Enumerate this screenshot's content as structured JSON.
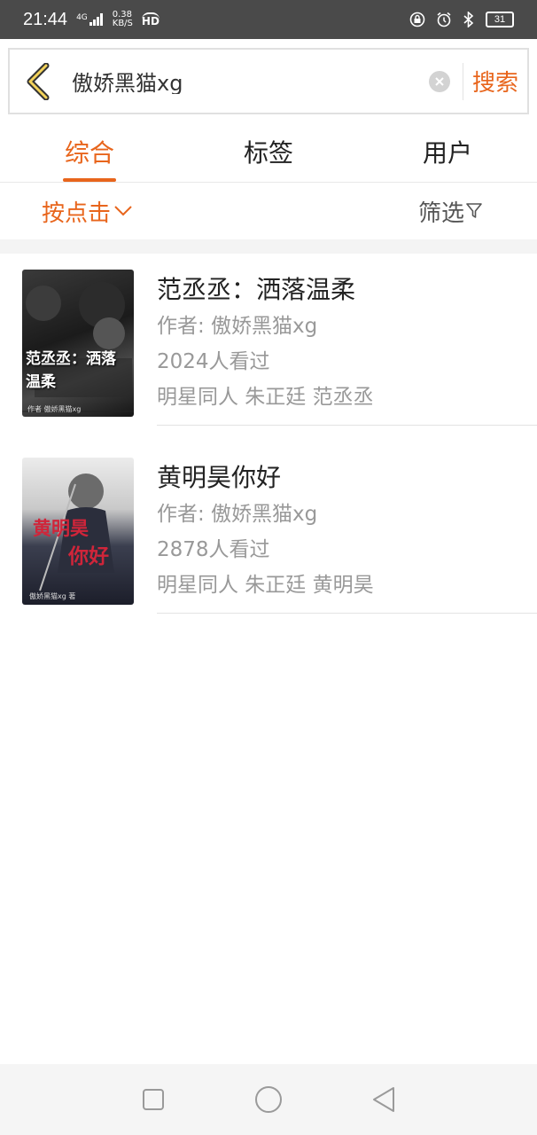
{
  "status_bar": {
    "time": "21:44",
    "network": "4G",
    "speed_value": "0.38",
    "speed_unit": "KB/S",
    "hd": "HD",
    "battery": "31"
  },
  "search": {
    "query": "傲娇黑猫xg",
    "button_label": "搜索"
  },
  "tabs": [
    {
      "label": "综合",
      "active": true
    },
    {
      "label": "标签",
      "active": false
    },
    {
      "label": "用户",
      "active": false
    }
  ],
  "filter_bar": {
    "sort_label": "按点击",
    "filter_label": "筛选"
  },
  "results": [
    {
      "title": "范丞丞：洒落温柔",
      "author": "作者: 傲娇黑猫xg",
      "views": "2024人看过",
      "tags": "明星同人 朱正廷 范丞丞",
      "cover_text": "范丞丞：洒落温柔",
      "cover_credit": "作者 傲娇黑猫xg"
    },
    {
      "title": "黄明昊你好",
      "author": "作者: 傲娇黑猫xg",
      "views": "2878人看过",
      "tags": "明星同人 朱正廷 黄明昊",
      "cover_text_1": "黄明昊",
      "cover_text_2": "你好",
      "cover_credit": "傲娇黑猫xg 著"
    }
  ],
  "colors": {
    "accent": "#e8651c",
    "status_bar": "#4a4a4a"
  }
}
